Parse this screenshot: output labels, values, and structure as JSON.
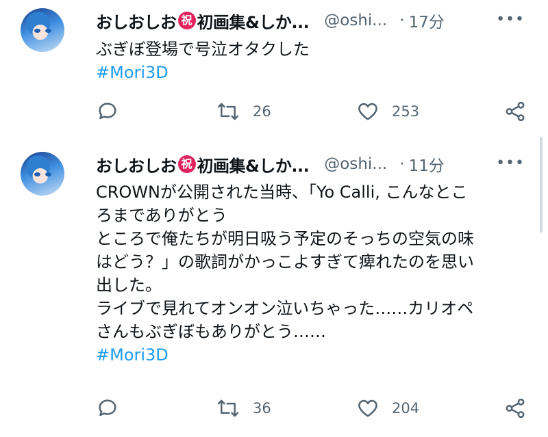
{
  "tweets": [
    {
      "author_name": "おしおしお",
      "author_badge": "祝",
      "author_name_suffix": "初画集&しか...",
      "handle": "@oshi...",
      "separator": "·",
      "time": "17分",
      "more_glyph": "•••",
      "lines": [
        "ぶぎぼ登場で号泣オタクした"
      ],
      "hashtag": "#Mori3D",
      "replies": "",
      "retweets": "26",
      "likes": "253"
    },
    {
      "author_name": "おしおしお",
      "author_badge": "祝",
      "author_name_suffix": "初画集&しか...",
      "handle": "@oshi...",
      "separator": "·",
      "time": "11分",
      "more_glyph": "•••",
      "lines": [
        "CROWNが公開された当時、「Yo Calli, こんなとこ",
        "ろまでありがとう",
        "ところで俺たちが明日吸う予定のそっちの空気の味",
        "はどう？」の歌詞がかっこよすぎて痺れたのを思い",
        "出した。",
        "ライブで見れてオンオン泣いちゃった……カリオペ",
        "さんもぶぎぼもありがとう……"
      ],
      "hashtag": "#Mori3D",
      "replies": "",
      "retweets": "36",
      "likes": "204"
    }
  ],
  "icons": [
    "reply-icon",
    "retweet-icon",
    "like-icon",
    "share-icon",
    "more-icon"
  ],
  "colors": {
    "link": "#1d9bf0",
    "muted": "#536471",
    "badge": "#e0245e"
  }
}
